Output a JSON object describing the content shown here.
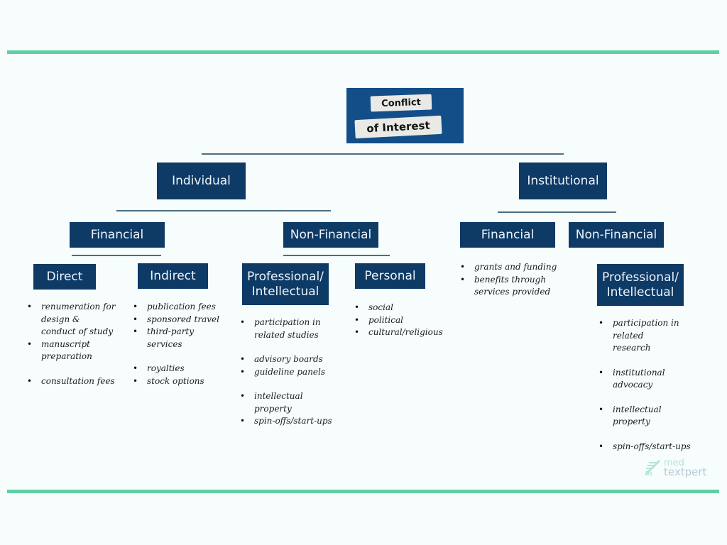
{
  "title": {
    "line1": "Conflict",
    "line2": "of Interest"
  },
  "branches": {
    "individual": {
      "label": "Individual",
      "financial": {
        "label": "Financial",
        "direct": {
          "label": "Direct",
          "items": [
            "renumeration for design & conduct of study",
            "manuscript preparation",
            "consultation fees"
          ]
        },
        "indirect": {
          "label": "Indirect",
          "items": [
            "publication fees",
            "sponsored travel",
            "third-party services",
            "royalties",
            "stock options"
          ]
        }
      },
      "non_financial": {
        "label": "Non-Financial",
        "professional": {
          "label_line1": "Professional/",
          "label_line2": "Intellectual",
          "items": [
            "participation in related studies",
            "advisory boards",
            "guideline panels",
            "intellectual property",
            "spin-offs/start-ups"
          ]
        },
        "personal": {
          "label": "Personal",
          "items": [
            "social",
            "political",
            "cultural/religious"
          ]
        }
      }
    },
    "institutional": {
      "label": "Institutional",
      "financial": {
        "label": "Financial",
        "items": [
          "grants and funding",
          "benefits through services provided"
        ]
      },
      "non_financial": {
        "label": "Non-Financial",
        "professional": {
          "label_line1": "Professional/",
          "label_line2": "Intellectual",
          "items": [
            "participation in related research",
            "institutional advocacy",
            "intellectual property",
            "spin-offs/start-ups"
          ]
        }
      }
    }
  },
  "logo": {
    "line1": "med",
    "line2": "textpert"
  },
  "colors": {
    "node_bg": "#0e3a66",
    "accent_rule": "#5fcfa6",
    "connector": "#4f6d7f",
    "background": "#f6fdfc"
  }
}
